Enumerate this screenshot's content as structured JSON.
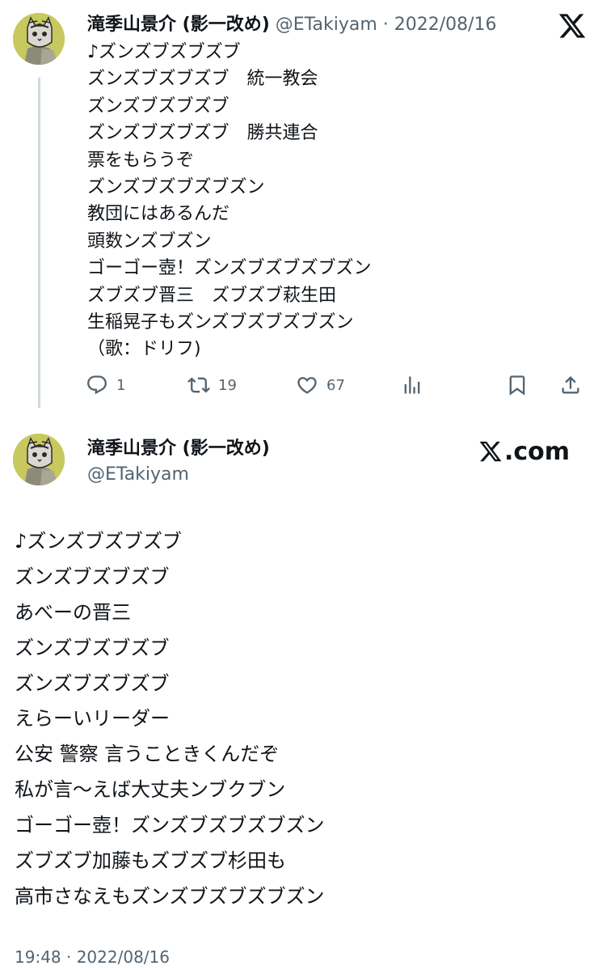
{
  "tweet1": {
    "display_name": "滝季山景介 (影一改め)",
    "handle": "@ETakiyam",
    "separator": " · ",
    "date": "2022/08/16",
    "lines": [
      "♪ズンズブズブズブ",
      "ズンズブズブズブ　統一教会",
      "ズンズブズブズブ",
      "ズンズブズブズブ　勝共連合",
      "票をもらうぞ",
      "ズンズブズブズブズン",
      "教団にはあるんだ",
      "頭数ンズブズン",
      "ゴーゴー壺！ズンズブズブズブズン",
      "ズブズブ晋三　ズブズブ萩生田",
      "生稲晃子もズンズブズブズブズン",
      "（歌：ドリフ)"
    ],
    "actions": {
      "reply_count": "1",
      "retweet_count": "19",
      "like_count": "67"
    },
    "icons": [
      "x-logo-icon",
      "reply-icon",
      "retweet-icon",
      "like-icon",
      "views-icon",
      "bookmark-icon",
      "share-icon"
    ]
  },
  "tweet2": {
    "display_name": "滝季山景介 (影一改め)",
    "handle": "@ETakiyam",
    "brand_text": ".com",
    "lines": [
      "♪ズンズブズブズブ",
      "ズンズブズブズブ",
      "あべーの晋三",
      "ズンズブズブズブ",
      "ズンズブズブズブ",
      "えらーいリーダー",
      "公安 警察 言うこときくんだぞ",
      "私が言～えば大丈夫ンブクブン",
      "ゴーゴー壺！ズンズブズブズブズン",
      "ズブズブ加藤もズブズブ杉田も",
      "高市さなえもズンズブズブズブズン"
    ],
    "timestamp": "19:48 · 2022/08/16"
  },
  "colors": {
    "text": "#0f1419",
    "secondary": "#536471",
    "thread_line": "#cfd9de",
    "avatar_bg": "#c7c85e"
  }
}
